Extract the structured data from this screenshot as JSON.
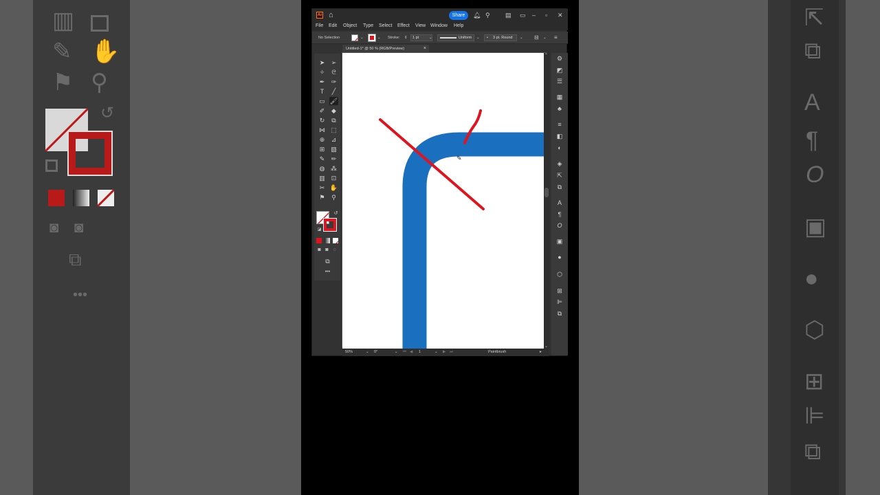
{
  "app": {
    "logo_text": "Ai",
    "share_label": "Share",
    "menu": [
      "File",
      "Edit",
      "Object",
      "Type",
      "Select",
      "Effect",
      "View",
      "Window",
      "Help"
    ],
    "control_bar": {
      "selection_label": "No Selection",
      "stroke_label": "Stroke:",
      "stroke_weight": "1 pt",
      "profile_label": "Uniform",
      "brush_label": "3 pt. Round"
    },
    "document_tab": {
      "title": "Untitled-1* @ 50 % (RGB/Preview)",
      "close": "×"
    },
    "status_bar": {
      "zoom": "50%",
      "rotation": "0°",
      "artboard_number": "1",
      "tool_name": "Paintbrush"
    }
  },
  "artwork": {
    "path_color": "#1a6fbf",
    "brush_color": "#e0141e"
  },
  "colors": {
    "accent_share": "#1473e6",
    "stroke_red": "#e0141e"
  }
}
